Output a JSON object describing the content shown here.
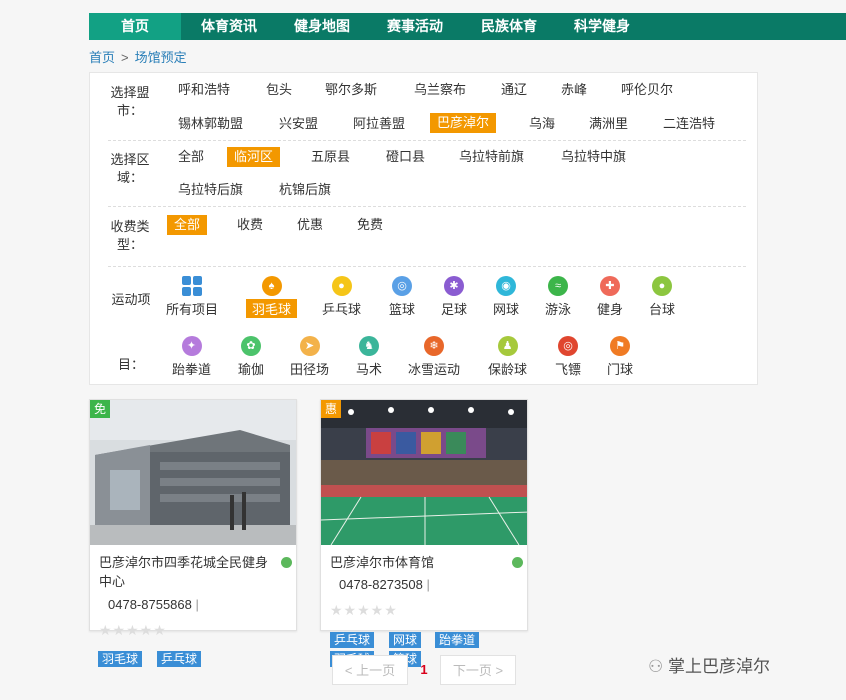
{
  "nav": {
    "items": [
      "首页",
      "体育资讯",
      "健身地图",
      "赛事活动",
      "民族体育",
      "科学健身"
    ]
  },
  "breadcrumb": {
    "home": "首页",
    "sep": ">",
    "current": "场馆预定"
  },
  "filters": {
    "city": {
      "label": "选择盟市：",
      "options": [
        "呼和浩特",
        "包头",
        "鄂尔多斯",
        "乌兰察布",
        "通辽",
        "赤峰",
        "呼伦贝尔",
        "锡林郭勒盟",
        "兴安盟",
        "阿拉善盟",
        "巴彦淖尔",
        "乌海",
        "满洲里",
        "二连浩特"
      ],
      "selected": "巴彦淖尔"
    },
    "area": {
      "label": "选择区域：",
      "options": [
        "全部",
        "临河区",
        "五原县",
        "磴口县",
        "乌拉特前旗",
        "乌拉特中旗",
        "乌拉特后旗",
        "杭锦后旗"
      ],
      "selected": "临河区"
    },
    "fee": {
      "label": "收费类型：",
      "options": [
        "全部",
        "收费",
        "优惠",
        "免费"
      ],
      "selected": "全部"
    },
    "sport": {
      "label_top": "运动项",
      "label_bottom": "目：",
      "items": [
        {
          "name": "所有项目",
          "icon": "grid-icon",
          "color": "#3a8ed6"
        },
        {
          "name": "羽毛球",
          "icon": "badminton-icon",
          "color": "#f39800"
        },
        {
          "name": "乒乓球",
          "icon": "table-tennis-icon",
          "color": "#f5c518"
        },
        {
          "name": "篮球",
          "icon": "basketball-icon",
          "color": "#5aa0e6"
        },
        {
          "name": "足球",
          "icon": "football-icon",
          "color": "#8a5cd1"
        },
        {
          "name": "网球",
          "icon": "tennis-icon",
          "color": "#2fb7d9"
        },
        {
          "name": "游泳",
          "icon": "swimming-icon",
          "color": "#3cb54a"
        },
        {
          "name": "健身",
          "icon": "fitness-icon",
          "color": "#ef6a5a"
        },
        {
          "name": "台球",
          "icon": "billiards-icon",
          "color": "#8cc63f"
        },
        {
          "name": "跆拳道",
          "icon": "taekwondo-icon",
          "color": "#b57bdc"
        },
        {
          "name": "瑜伽",
          "icon": "yoga-icon",
          "color": "#4cc36b"
        },
        {
          "name": "田径场",
          "icon": "track-icon",
          "color": "#f3b24a"
        },
        {
          "name": "马术",
          "icon": "equestrian-icon",
          "color": "#3bb59a"
        },
        {
          "name": "冰雪运动",
          "icon": "ski-icon",
          "color": "#e8672a"
        },
        {
          "name": "保龄球",
          "icon": "bowling-icon",
          "color": "#a6c93c"
        },
        {
          "name": "飞镖",
          "icon": "darts-icon",
          "color": "#e0462f"
        },
        {
          "name": "门球",
          "icon": "gateball-icon",
          "color": "#f07b24"
        }
      ],
      "selected": "羽毛球"
    }
  },
  "venues": [
    {
      "badge": "免",
      "badge_color": "#3cb54a",
      "name_line1": "巴彦淖尔市四季花城全民健身",
      "name_line2": "中心",
      "phone": "0478-8755868",
      "stars": "★★★★★",
      "tags": [
        "羽毛球",
        "乒乓球"
      ]
    },
    {
      "badge": "惠",
      "badge_color": "#f39800",
      "name_line1": "巴彦淖尔市体育馆",
      "name_line2": "",
      "phone": "0478-8273508",
      "stars": "★★★★★",
      "tags": [
        "乒乓球",
        "网球",
        "跆拳道",
        "羽毛球",
        "篮球"
      ]
    }
  ],
  "pagination": {
    "prev": "< 上一页",
    "current": "1",
    "next": "下一页 >"
  },
  "watermark": "掌上巴彦淖尔",
  "colors": {
    "nav_bg": "#0a7a66",
    "nav_active": "#12a184",
    "accent": "#f39800",
    "tag": "#3a8ed6",
    "link": "#2a7fb8"
  }
}
